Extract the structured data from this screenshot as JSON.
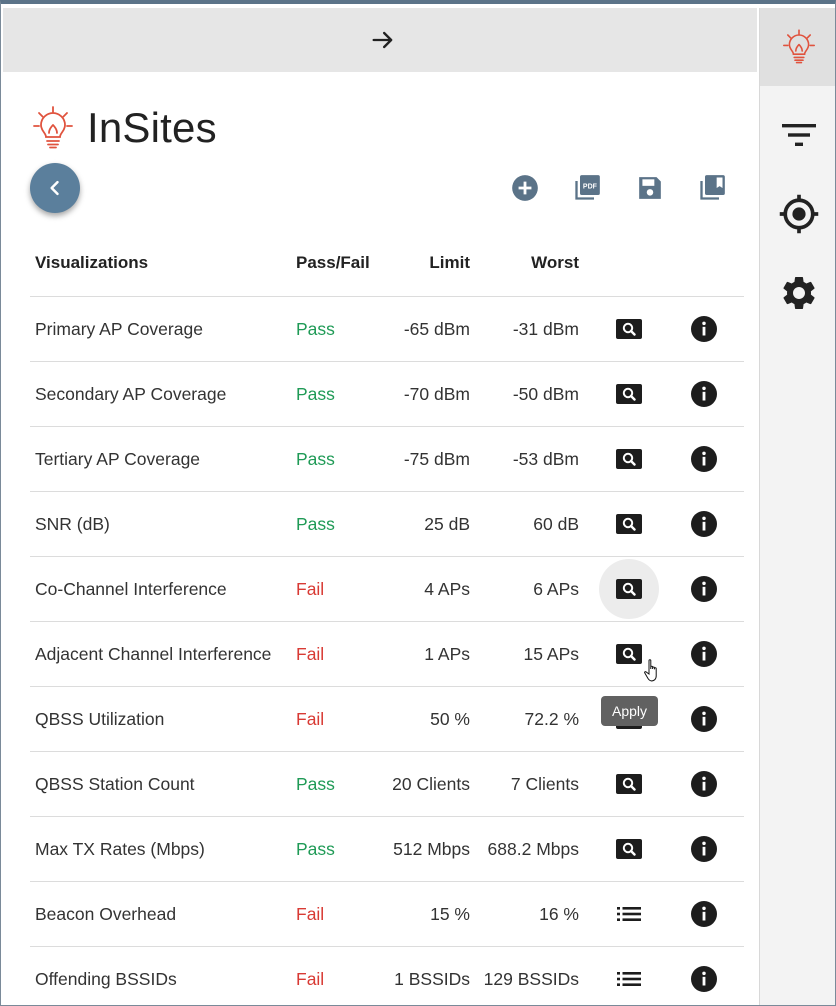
{
  "app": {
    "title": "InSites"
  },
  "colors": {
    "pass": "#1f9a56",
    "fail": "#d83a34",
    "accent": "#5b7f9c",
    "bulb": "#e0533e"
  },
  "toolbar": {
    "icons": [
      "add-circle-icon",
      "pdf-icon",
      "save-icon",
      "library-icon"
    ]
  },
  "table": {
    "headers": {
      "name": "Visualizations",
      "pass_fail": "Pass/Fail",
      "limit": "Limit",
      "worst": "Worst"
    },
    "rows": [
      {
        "name": "Primary AP Coverage",
        "status": "Pass",
        "limit": "-65 dBm",
        "worst": "-31 dBm",
        "action": "search"
      },
      {
        "name": "Secondary AP Coverage",
        "status": "Pass",
        "limit": "-70 dBm",
        "worst": "-50 dBm",
        "action": "search"
      },
      {
        "name": "Tertiary AP Coverage",
        "status": "Pass",
        "limit": "-75 dBm",
        "worst": "-53 dBm",
        "action": "search"
      },
      {
        "name": "SNR (dB)",
        "status": "Pass",
        "limit": "25 dB",
        "worst": "60 dB",
        "action": "search"
      },
      {
        "name": "Co-Channel Interference",
        "status": "Fail",
        "limit": "4 APs",
        "worst": "6 APs",
        "action": "search"
      },
      {
        "name": "Adjacent Channel Interference",
        "status": "Fail",
        "limit": "1 APs",
        "worst": "15 APs",
        "action": "search"
      },
      {
        "name": "QBSS Utilization",
        "status": "Fail",
        "limit": "50 %",
        "worst": "72.2 %",
        "action": "search"
      },
      {
        "name": "QBSS Station Count",
        "status": "Pass",
        "limit": "20 Clients",
        "worst": "7 Clients",
        "action": "search"
      },
      {
        "name": "Max TX Rates (Mbps)",
        "status": "Pass",
        "limit": "512 Mbps",
        "worst": "688.2 Mbps",
        "action": "search"
      },
      {
        "name": "Beacon Overhead",
        "status": "Fail",
        "limit": "15 %",
        "worst": "16 %",
        "action": "list"
      },
      {
        "name": "Offending BSSIDs",
        "status": "Fail",
        "limit": "1 BSSIDs",
        "worst": "129 BSSIDs",
        "action": "list"
      }
    ]
  },
  "tooltip": {
    "text": "Apply"
  },
  "sidebar": {
    "items": [
      "insites-bulb-icon",
      "filter-icon",
      "target-icon",
      "settings-gear-icon"
    ]
  }
}
